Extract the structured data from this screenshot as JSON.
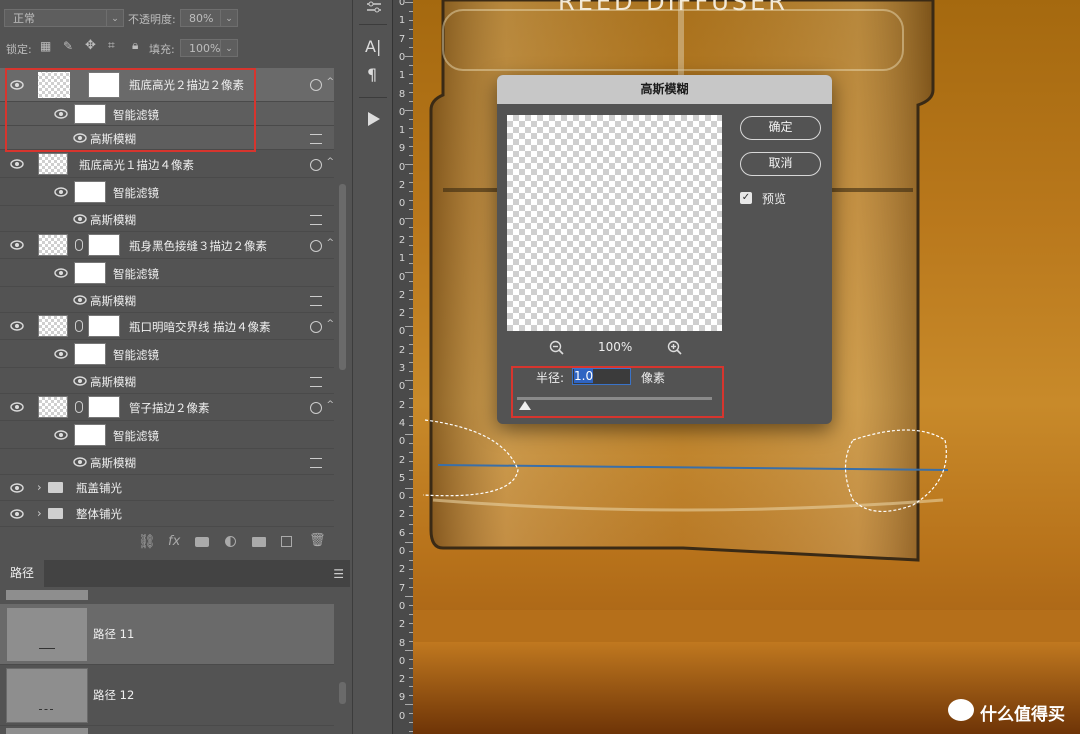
{
  "layers_toolbar": {
    "blend_mode": "正常",
    "opacity_label": "不透明度:",
    "opacity_value": "80%",
    "lock_label": "锁定:",
    "fill_label": "填充:",
    "fill_value": "100%"
  },
  "layers": [
    {
      "name": "瓶底高光２描边２像素",
      "filter_group": "智能滤镜",
      "filter": "高斯模糊",
      "selected": true
    },
    {
      "name": "瓶底高光１描边４像素",
      "filter_group": "智能滤镜",
      "filter": "高斯模糊"
    },
    {
      "name": "瓶身黑色接缝３描边２像素",
      "filter_group": "智能滤镜",
      "filter": "高斯模糊"
    },
    {
      "name": "瓶口明暗交界线 描边４像素",
      "filter_group": "智能滤镜",
      "filter": "高斯模糊"
    },
    {
      "name": "管子描边２像素",
      "filter_group": "智能滤镜",
      "filter": "高斯模糊"
    }
  ],
  "groups": [
    {
      "name": "瓶盖铺光"
    },
    {
      "name": "整体铺光"
    }
  ],
  "paths_panel": {
    "tab": "路径",
    "items": [
      {
        "name": "路径 11"
      },
      {
        "name": "路径 12"
      }
    ]
  },
  "ruler_labels": [
    "0",
    "1",
    "7",
    "0",
    "1",
    "8",
    "0",
    "1",
    "9",
    "0",
    "2",
    "0",
    "0",
    "2",
    "1",
    "0",
    "2",
    "2",
    "0",
    "2",
    "3",
    "0",
    "2",
    "4",
    "0",
    "2",
    "5",
    "0",
    "2",
    "6",
    "0",
    "2",
    "7",
    "0",
    "2",
    "8",
    "0",
    "2",
    "9",
    "0"
  ],
  "canvas": {
    "bottle_text": "REED DIFFUSER",
    "watermark": "什么值得买"
  },
  "gaussian_dialog": {
    "title": "高斯模糊",
    "ok_label": "确定",
    "cancel_label": "取消",
    "preview_label": "预览",
    "preview_checked": true,
    "zoom_value": "100%",
    "radius_label": "半径:",
    "radius_value": "1.0",
    "radius_unit": "像素"
  },
  "colors": {
    "panel": "#535353",
    "highlight": "#d7352e",
    "selection_blue": "#2f64c2"
  }
}
